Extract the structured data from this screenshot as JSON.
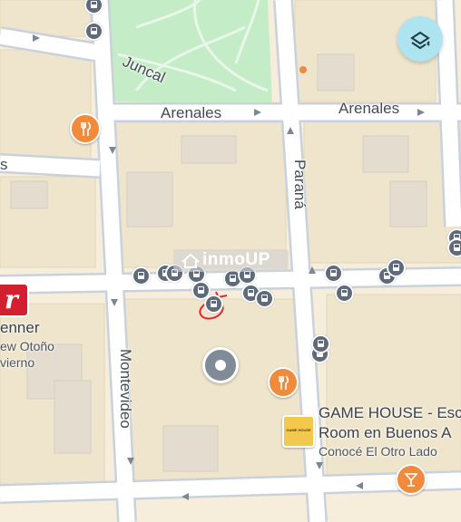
{
  "map": {
    "streets": {
      "juncal": "Juncal",
      "arenales_left": "Arenales",
      "arenales_right": "Arenales",
      "parana": "Paraná",
      "montevideo": "Montevideo",
      "left_edge": "s"
    },
    "watermark": "inmoUP",
    "places": {
      "renner_name": "enner",
      "renner_line2": "ew Otoño",
      "renner_line3": "vierno",
      "renner_logo": "r",
      "gamehouse_name_line1": "GAME HOUSE - Esc",
      "gamehouse_name_line2": "Room en Buenos A",
      "gamehouse_tagline": "Conocé El Otro Lado",
      "gamehouse_logo": "GAME HOUSE"
    },
    "colors": {
      "background": "#f6eedb",
      "park": "#c4ecc7",
      "road": "#b8c3cf",
      "restaurant": "#f08a3d",
      "bar": "#f08a3d",
      "bus_stop": "#5f6b7a",
      "layers_button": "#aee3f0"
    },
    "icons": {
      "layers": "layers-icon",
      "bus": "bus-stop-icon",
      "restaurant": "fork-knife-icon",
      "bar": "cocktail-icon",
      "pin": "location-pin-icon"
    }
  }
}
